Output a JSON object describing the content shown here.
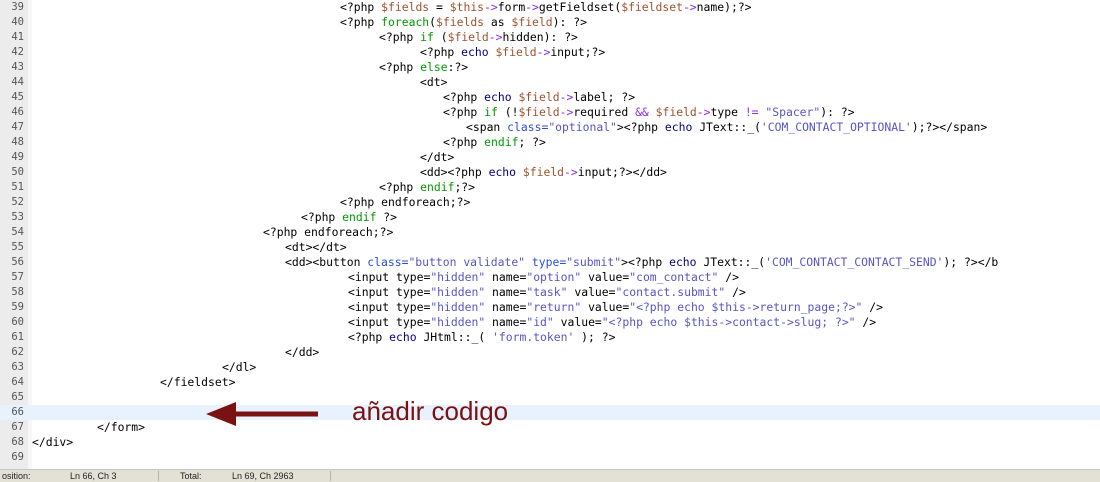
{
  "editor": {
    "lines": [
      {
        "n": "39",
        "indent": 340,
        "tokens": [
          [
            "t",
            "<?php "
          ],
          [
            "v",
            "$fields"
          ],
          [
            "t",
            " = "
          ],
          [
            "v",
            "$this"
          ],
          [
            "o",
            "->"
          ],
          [
            "t",
            "form"
          ],
          [
            "o",
            "->"
          ],
          [
            "t",
            "getFieldset("
          ],
          [
            "v",
            "$fieldset"
          ],
          [
            "o",
            "->"
          ],
          [
            "t",
            "name);?>"
          ]
        ]
      },
      {
        "n": "40",
        "indent": 340,
        "tokens": [
          [
            "t",
            "<?php "
          ],
          [
            "k",
            "foreach"
          ],
          [
            "t",
            "("
          ],
          [
            "v",
            "$fields"
          ],
          [
            "t",
            " as "
          ],
          [
            "v",
            "$field"
          ],
          [
            "t",
            "): ?>"
          ]
        ]
      },
      {
        "n": "41",
        "indent": 379,
        "tokens": [
          [
            "t",
            "<?php "
          ],
          [
            "k",
            "if"
          ],
          [
            "t",
            " ("
          ],
          [
            "v",
            "$field"
          ],
          [
            "o",
            "->"
          ],
          [
            "t",
            "hidden): ?>"
          ]
        ]
      },
      {
        "n": "42",
        "indent": 420,
        "tokens": [
          [
            "t",
            "<?php "
          ],
          [
            "e",
            "echo"
          ],
          [
            "t",
            " "
          ],
          [
            "v",
            "$field"
          ],
          [
            "o",
            "->"
          ],
          [
            "t",
            "input;?>"
          ]
        ]
      },
      {
        "n": "43",
        "indent": 379,
        "tokens": [
          [
            "t",
            "<?php "
          ],
          [
            "k",
            "else"
          ],
          [
            "t",
            ":?>"
          ]
        ]
      },
      {
        "n": "44",
        "indent": 420,
        "tokens": [
          [
            "tag",
            "<dt>"
          ]
        ]
      },
      {
        "n": "45",
        "indent": 443,
        "tokens": [
          [
            "t",
            "<?php "
          ],
          [
            "e",
            "echo"
          ],
          [
            "t",
            " "
          ],
          [
            "v",
            "$field"
          ],
          [
            "o",
            "->"
          ],
          [
            "t",
            "label; ?>"
          ]
        ]
      },
      {
        "n": "46",
        "indent": 443,
        "tokens": [
          [
            "t",
            "<?php "
          ],
          [
            "k",
            "if"
          ],
          [
            "t",
            " (!"
          ],
          [
            "v",
            "$field"
          ],
          [
            "o",
            "->"
          ],
          [
            "t",
            "required "
          ],
          [
            "o",
            "&&"
          ],
          [
            "t",
            " "
          ],
          [
            "v",
            "$field"
          ],
          [
            "o",
            "->"
          ],
          [
            "t",
            "type "
          ],
          [
            "o",
            "!="
          ],
          [
            "t",
            " "
          ],
          [
            "st",
            "\"Spacer\""
          ],
          [
            "t",
            "): ?>"
          ]
        ]
      },
      {
        "n": "47",
        "indent": 466,
        "tokens": [
          [
            "tag",
            "<span "
          ],
          [
            "s",
            "class="
          ],
          [
            "st",
            "\"optional\""
          ],
          [
            "tag",
            ">"
          ],
          [
            "t",
            "<?php "
          ],
          [
            "e",
            "echo"
          ],
          [
            "t",
            " JText::_("
          ],
          [
            "st",
            "'COM_CONTACT_OPTIONAL'"
          ],
          [
            "t",
            ");?></span>"
          ]
        ]
      },
      {
        "n": "48",
        "indent": 443,
        "tokens": [
          [
            "t",
            "<?php "
          ],
          [
            "k",
            "endif"
          ],
          [
            "t",
            "; ?>"
          ]
        ]
      },
      {
        "n": "49",
        "indent": 420,
        "tokens": [
          [
            "tag",
            "</dt>"
          ]
        ]
      },
      {
        "n": "50",
        "indent": 420,
        "tokens": [
          [
            "tag",
            "<dd>"
          ],
          [
            "t",
            "<?php "
          ],
          [
            "e",
            "echo"
          ],
          [
            "t",
            " "
          ],
          [
            "v",
            "$field"
          ],
          [
            "o",
            "->"
          ],
          [
            "t",
            "input;?></dd>"
          ]
        ]
      },
      {
        "n": "51",
        "indent": 379,
        "tokens": [
          [
            "t",
            "<?php "
          ],
          [
            "k",
            "endif"
          ],
          [
            "t",
            ";?>"
          ]
        ]
      },
      {
        "n": "52",
        "indent": 340,
        "tokens": [
          [
            "t",
            "<?php endforeach;?>"
          ]
        ]
      },
      {
        "n": "53",
        "indent": 301,
        "tokens": [
          [
            "t",
            "<?php "
          ],
          [
            "k",
            "endif"
          ],
          [
            "t",
            " ?>"
          ]
        ]
      },
      {
        "n": "54",
        "indent": 263,
        "tokens": [
          [
            "t",
            "<?php endforeach;?>"
          ]
        ]
      },
      {
        "n": "55",
        "indent": 285,
        "tokens": [
          [
            "tag",
            "<dt></dt>"
          ]
        ]
      },
      {
        "n": "56",
        "indent": 285,
        "tokens": [
          [
            "tag",
            "<dd><button "
          ],
          [
            "s",
            "class="
          ],
          [
            "st",
            "\"button validate\""
          ],
          [
            "t",
            " "
          ],
          [
            "s",
            "type="
          ],
          [
            "st",
            "\"submit\""
          ],
          [
            "tag",
            ">"
          ],
          [
            "t",
            "<?php "
          ],
          [
            "e",
            "echo"
          ],
          [
            "t",
            " JText::_("
          ],
          [
            "st",
            "'COM_CONTACT_CONTACT_SEND'"
          ],
          [
            "t",
            "); ?></b"
          ]
        ]
      },
      {
        "n": "57",
        "indent": 348,
        "tokens": [
          [
            "tag",
            "<input "
          ],
          [
            "t",
            "type="
          ],
          [
            "st",
            "\"hidden\""
          ],
          [
            "t",
            " name="
          ],
          [
            "st",
            "\"option\""
          ],
          [
            "t",
            " value="
          ],
          [
            "st",
            "\"com_contact\""
          ],
          [
            "t",
            " />"
          ]
        ]
      },
      {
        "n": "58",
        "indent": 348,
        "tokens": [
          [
            "tag",
            "<input "
          ],
          [
            "t",
            "type="
          ],
          [
            "st",
            "\"hidden\""
          ],
          [
            "t",
            " name="
          ],
          [
            "st",
            "\"task\""
          ],
          [
            "t",
            " value="
          ],
          [
            "st",
            "\"contact.submit\""
          ],
          [
            "t",
            " />"
          ]
        ]
      },
      {
        "n": "59",
        "indent": 348,
        "tokens": [
          [
            "tag",
            "<input "
          ],
          [
            "t",
            "type="
          ],
          [
            "st",
            "\"hidden\""
          ],
          [
            "t",
            " name="
          ],
          [
            "st",
            "\"return\""
          ],
          [
            "t",
            " value="
          ],
          [
            "st",
            "\"<?php echo $this->return_page;?>\""
          ],
          [
            "t",
            " />"
          ]
        ]
      },
      {
        "n": "60",
        "indent": 348,
        "tokens": [
          [
            "tag",
            "<input "
          ],
          [
            "t",
            "type="
          ],
          [
            "st",
            "\"hidden\""
          ],
          [
            "t",
            " name="
          ],
          [
            "st",
            "\"id\""
          ],
          [
            "t",
            " value="
          ],
          [
            "st",
            "\"<?php echo $this->contact->slug; ?>\""
          ],
          [
            "t",
            " />"
          ]
        ]
      },
      {
        "n": "61",
        "indent": 348,
        "tokens": [
          [
            "t",
            "<?php "
          ],
          [
            "e",
            "echo"
          ],
          [
            "t",
            " JHtml::_( "
          ],
          [
            "st",
            "'form.token'"
          ],
          [
            "t",
            " ); ?>"
          ]
        ]
      },
      {
        "n": "62",
        "indent": 285,
        "tokens": [
          [
            "tag",
            "</dd>"
          ]
        ]
      },
      {
        "n": "63",
        "indent": 222,
        "tokens": [
          [
            "tag",
            "</dl>"
          ]
        ]
      },
      {
        "n": "64",
        "indent": 160,
        "tokens": [
          [
            "tag",
            "</fieldset>"
          ]
        ]
      },
      {
        "n": "65",
        "indent": 32,
        "tokens": []
      },
      {
        "n": "66",
        "indent": 32,
        "tokens": [],
        "current": true
      },
      {
        "n": "67",
        "indent": 97,
        "tokens": [
          [
            "tag",
            "</form>"
          ]
        ]
      },
      {
        "n": "68",
        "indent": 32,
        "tokens": [
          [
            "tag",
            "</div>"
          ]
        ]
      },
      {
        "n": "69",
        "indent": 32,
        "tokens": []
      }
    ]
  },
  "annotation": {
    "text": "añadir codigo",
    "color": "#7a1212"
  },
  "statusbar": {
    "position_label": "osition:",
    "position_value": "Ln 66, Ch 3",
    "total_label": "Total:",
    "total_value": "Ln 69, Ch 2963"
  }
}
